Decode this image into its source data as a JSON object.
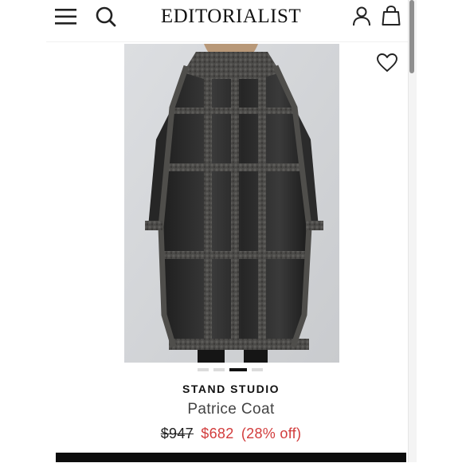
{
  "header": {
    "logo_text": "EDITORIALIST",
    "menu_icon": "hamburger-menu-icon",
    "search_icon": "search-icon",
    "account_icon": "user-account-icon",
    "bag_icon": "shopping-bag-icon"
  },
  "product": {
    "brand": "STAND STUDIO",
    "name": "Patrice Coat",
    "price_original": "$947",
    "price_sale": "$682",
    "discount": "(28% off)",
    "wishlist_icon": "heart-icon",
    "carousel": {
      "count": 4,
      "active_index": 2
    }
  },
  "colors": {
    "sale_price": "#d23c3c",
    "text_dark": "#111111",
    "cta_bar": "#0d0d0d"
  }
}
